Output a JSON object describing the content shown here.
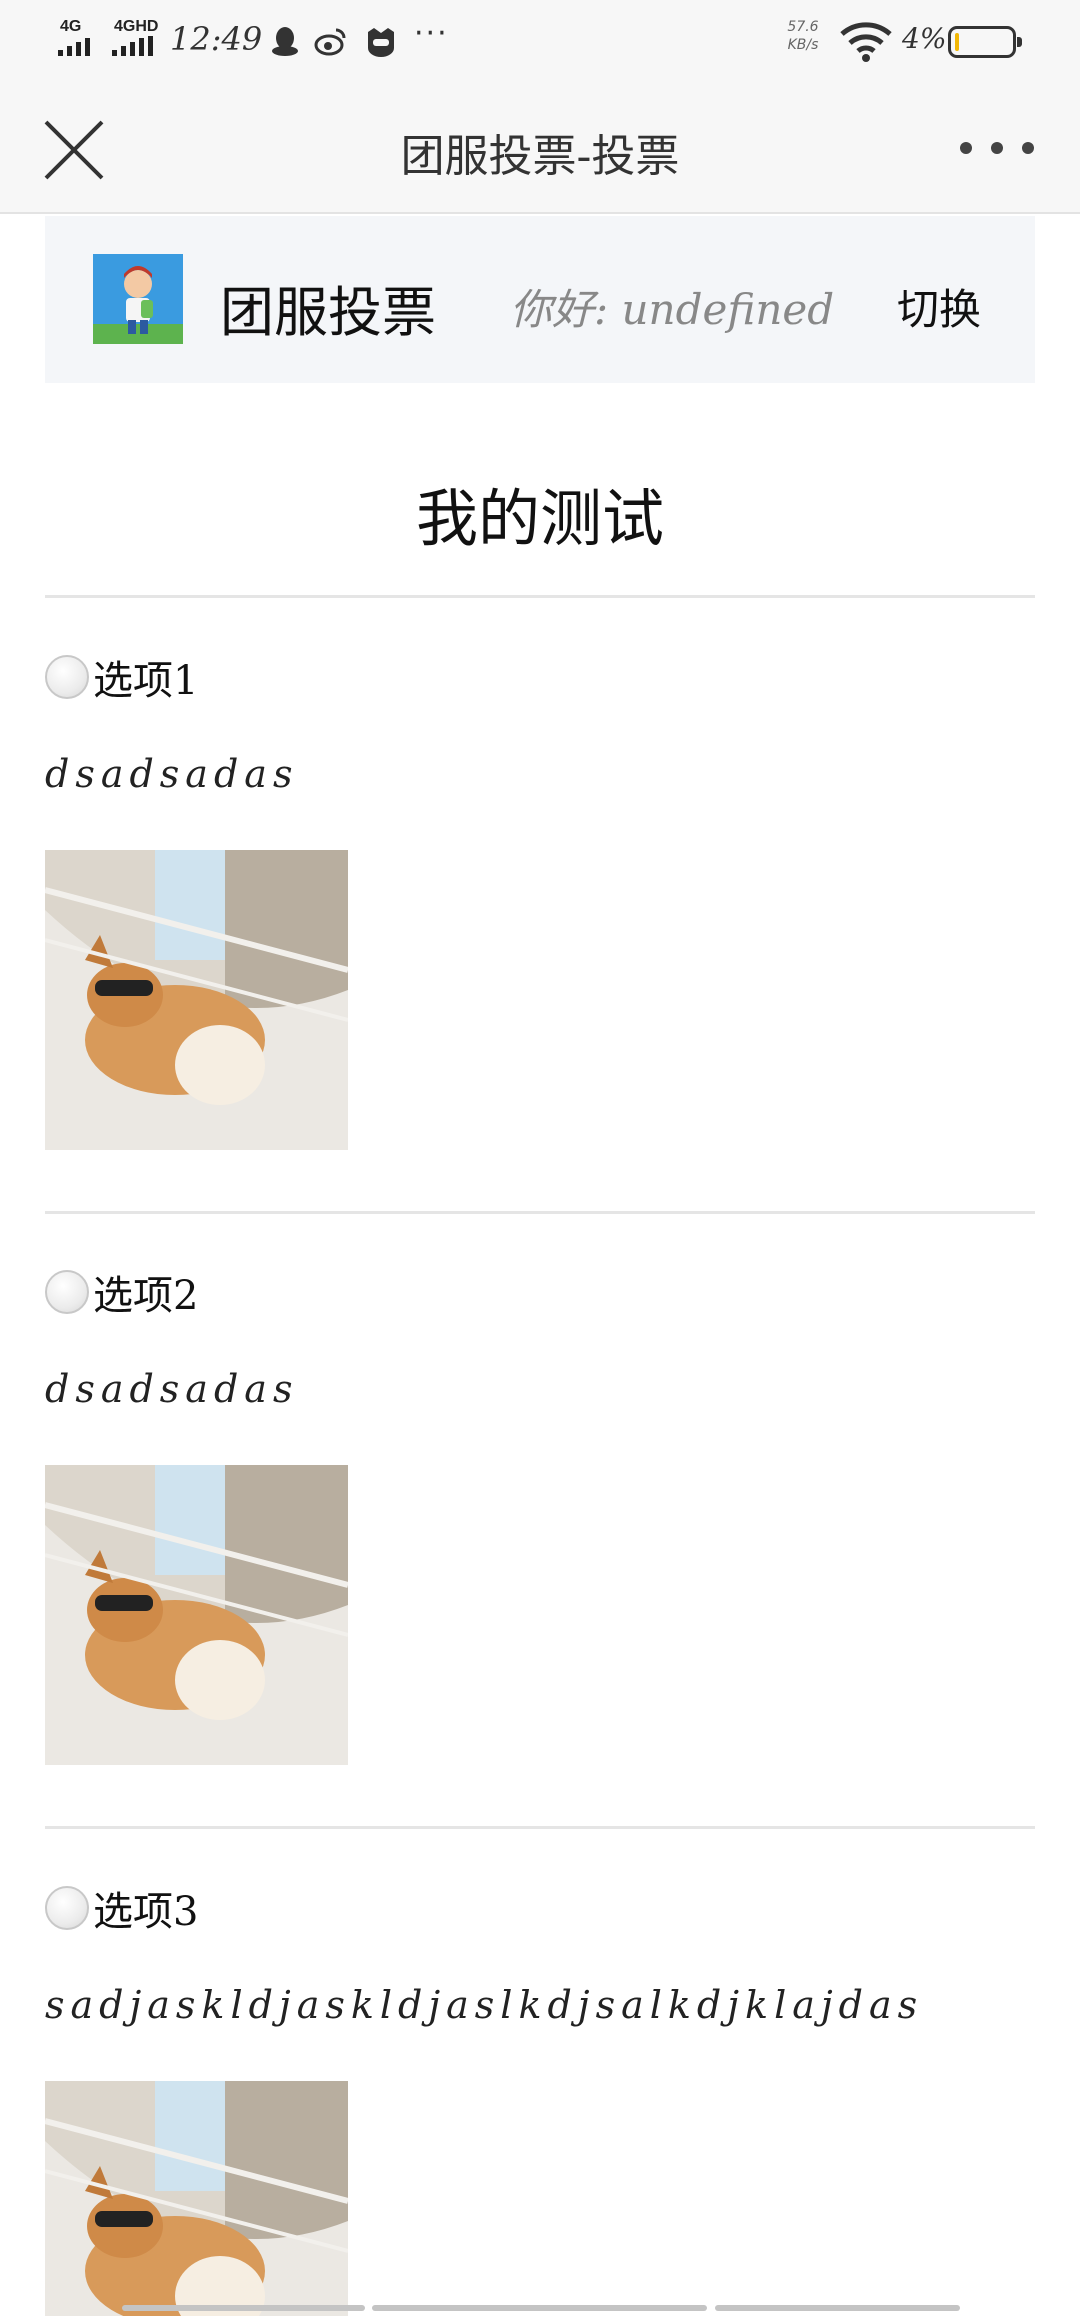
{
  "status_bar": {
    "signal1_label": "4G",
    "signal2_label": "4GHD",
    "time": "12:49",
    "more": "···",
    "net_speed_value": "57.6",
    "net_speed_unit": "KB/s",
    "battery_percent": "4%",
    "battery_level": 0.04,
    "icons": [
      "qq-icon",
      "weibo-icon",
      "app-icon",
      "wifi-icon",
      "battery-icon"
    ]
  },
  "nav": {
    "title": "团服投票-投票"
  },
  "header": {
    "site_name": "团服投票",
    "greeting": "你好: undefined",
    "switch_label": "切换"
  },
  "page_title": "我的测试",
  "options": [
    {
      "label": "选项1",
      "description": "dsadsadas",
      "image_alt": "shiba-dog-hammock"
    },
    {
      "label": "选项2",
      "description": "dsadsadas",
      "image_alt": "shiba-dog-hammock"
    },
    {
      "label": "选项3",
      "description": "sadjaskldjaskldjaslkdjsalkdjklajdas",
      "image_alt": "shiba-dog-hammock"
    }
  ],
  "colors": {
    "bar_bg": "#f7f7f7",
    "card_bg": "#f4f6f9",
    "divider": "#e5e5e5",
    "battery_low": "#f2b705"
  }
}
